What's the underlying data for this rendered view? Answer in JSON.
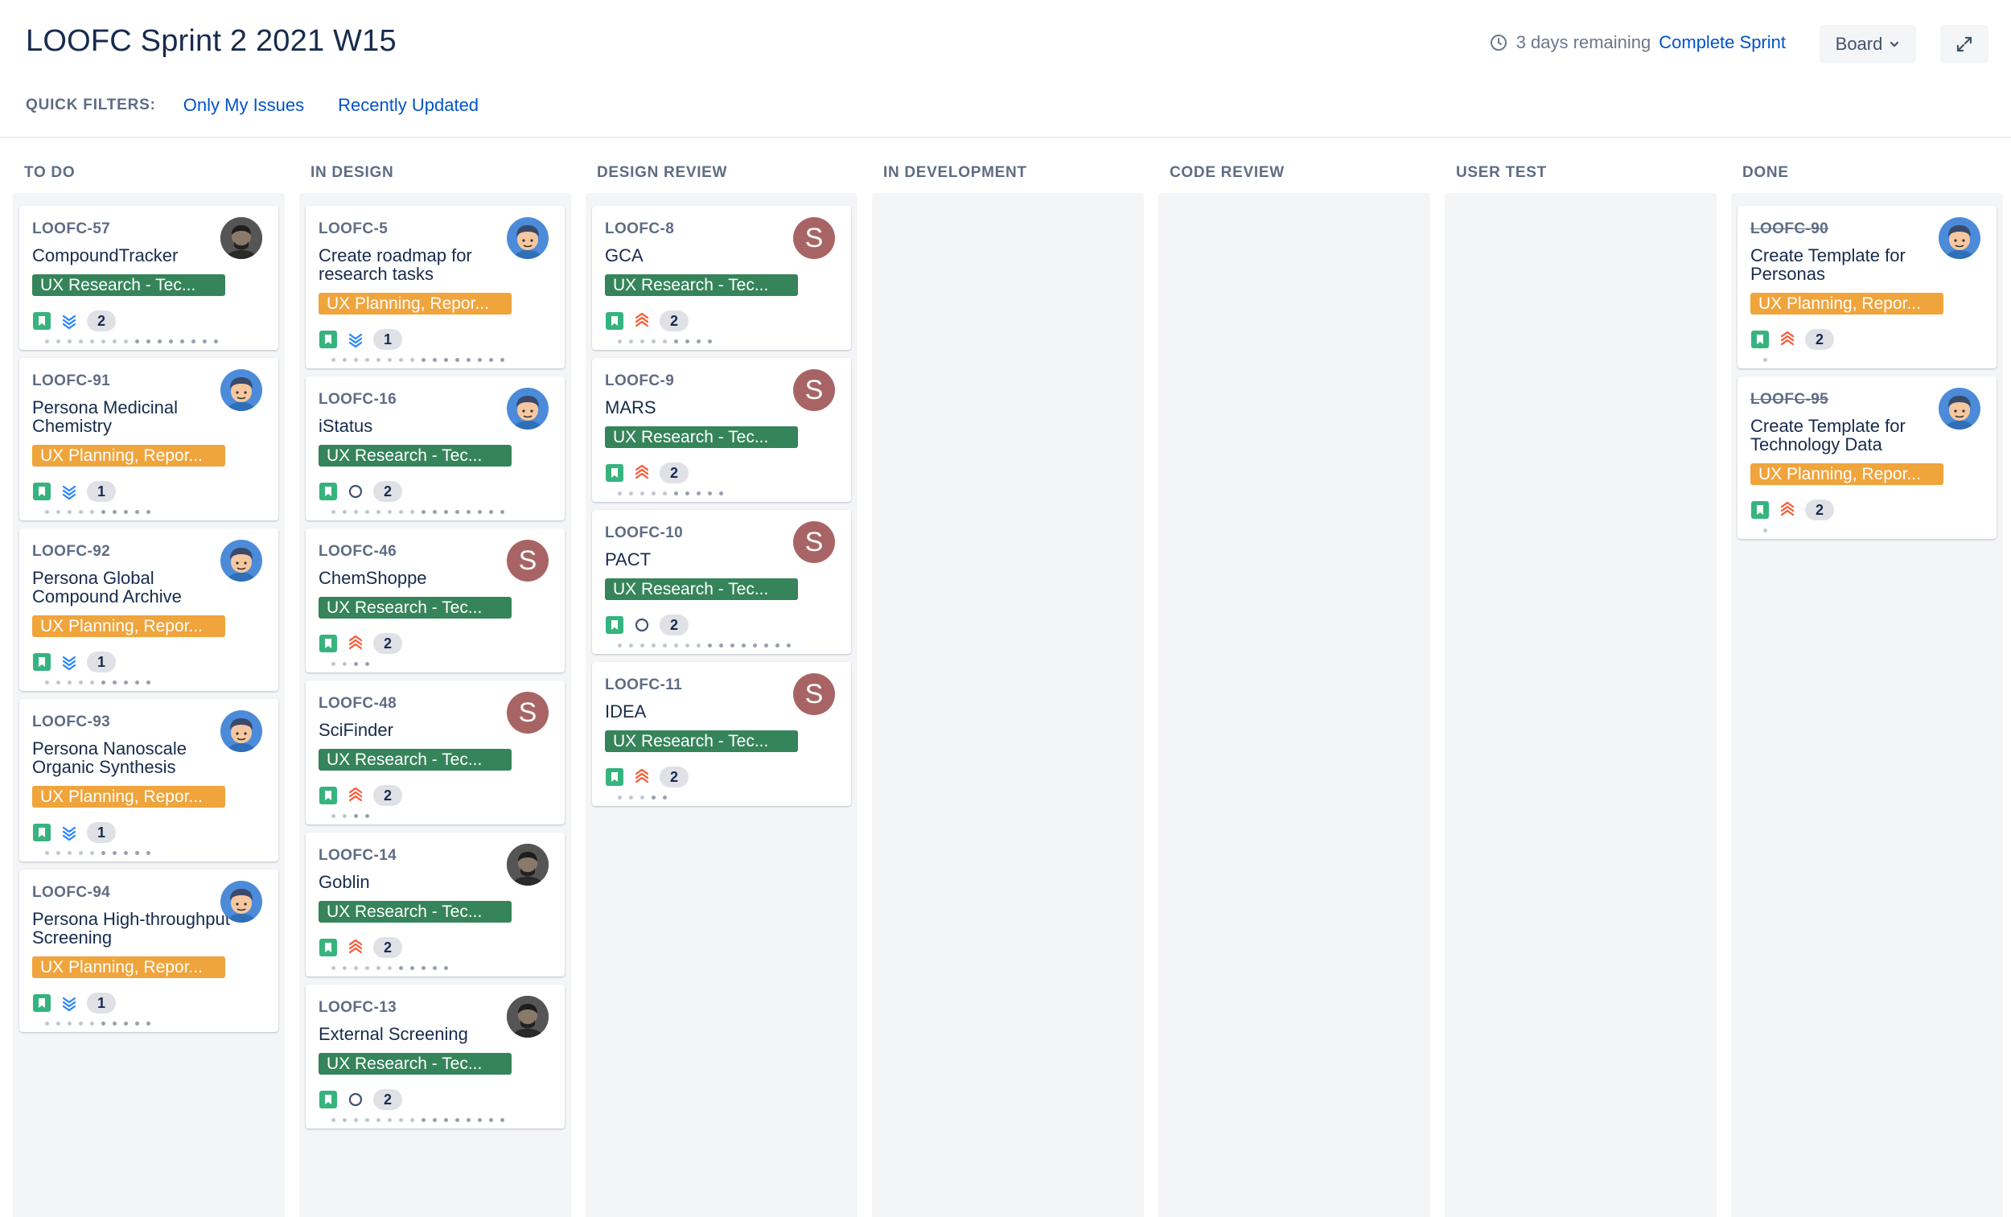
{
  "header": {
    "title": "LOOFC Sprint 2 2021 W15",
    "days_remaining": "3 days remaining",
    "complete_sprint": "Complete Sprint",
    "board_label": "Board",
    "quick_filters_label": "QUICK FILTERS:",
    "quick_filters": [
      "Only My Issues",
      "Recently Updated"
    ]
  },
  "columns": [
    {
      "title": "TO DO",
      "cards": [
        {
          "key": "LOOFC-57",
          "summary": "CompoundTracker",
          "epic": "UX Research - Tec...",
          "epic_color": "green",
          "priority": "lowest",
          "estimate": "2",
          "avatar": "dark",
          "done": false,
          "dots": 16
        },
        {
          "key": "LOOFC-91",
          "summary": "Persona Medicinal Chemistry",
          "epic": "UX Planning, Repor...",
          "epic_color": "orange",
          "priority": "lowest",
          "estimate": "1",
          "avatar": "blue",
          "done": false,
          "dots": 10
        },
        {
          "key": "LOOFC-92",
          "summary": "Persona Global Compound Archive",
          "epic": "UX Planning, Repor...",
          "epic_color": "orange",
          "priority": "lowest",
          "estimate": "1",
          "avatar": "blue",
          "done": false,
          "dots": 10
        },
        {
          "key": "LOOFC-93",
          "summary": "Persona Nanoscale Organic Synthesis",
          "epic": "UX Planning, Repor...",
          "epic_color": "orange",
          "priority": "lowest",
          "estimate": "1",
          "avatar": "blue",
          "done": false,
          "dots": 10
        },
        {
          "key": "LOOFC-94",
          "summary": "Persona High-throughput Screening",
          "epic": "UX Planning, Repor...",
          "epic_color": "orange",
          "priority": "lowest",
          "estimate": "1",
          "avatar": "blue",
          "done": false,
          "dots": 10
        }
      ]
    },
    {
      "title": "IN DESIGN",
      "cards": [
        {
          "key": "LOOFC-5",
          "summary": "Create roadmap for research tasks",
          "epic": "UX Planning, Repor...",
          "epic_color": "orange",
          "priority": "lowest",
          "estimate": "1",
          "avatar": "blue",
          "done": false,
          "dots": 16
        },
        {
          "key": "LOOFC-16",
          "summary": "iStatus",
          "epic": "UX Research - Tec...",
          "epic_color": "green",
          "priority": "none",
          "estimate": "2",
          "avatar": "blue",
          "done": false,
          "dots": 16
        },
        {
          "key": "LOOFC-46",
          "summary": "ChemShoppe",
          "epic": "UX Research - Tec...",
          "epic_color": "green",
          "priority": "highest",
          "estimate": "2",
          "avatar": "s",
          "done": false,
          "dots": 4
        },
        {
          "key": "LOOFC-48",
          "summary": "SciFinder",
          "epic": "UX Research - Tec...",
          "epic_color": "green",
          "priority": "highest",
          "estimate": "2",
          "avatar": "s",
          "done": false,
          "dots": 4
        },
        {
          "key": "LOOFC-14",
          "summary": "Goblin",
          "epic": "UX Research - Tec...",
          "epic_color": "green",
          "priority": "highest",
          "estimate": "2",
          "avatar": "dark",
          "done": false,
          "dots": 11
        },
        {
          "key": "LOOFC-13",
          "summary": "External Screening",
          "epic": "UX Research - Tec...",
          "epic_color": "green",
          "priority": "none",
          "estimate": "2",
          "avatar": "dark",
          "done": false,
          "dots": 16
        }
      ]
    },
    {
      "title": "DESIGN REVIEW",
      "cards": [
        {
          "key": "LOOFC-8",
          "summary": "GCA",
          "epic": "UX Research - Tec...",
          "epic_color": "green",
          "priority": "highest",
          "estimate": "2",
          "avatar": "s",
          "done": false,
          "dots": 9
        },
        {
          "key": "LOOFC-9",
          "summary": "MARS",
          "epic": "UX Research - Tec...",
          "epic_color": "green",
          "priority": "highest",
          "estimate": "2",
          "avatar": "s",
          "done": false,
          "dots": 10
        },
        {
          "key": "LOOFC-10",
          "summary": "PACT",
          "epic": "UX Research - Tec...",
          "epic_color": "green",
          "priority": "none",
          "estimate": "2",
          "avatar": "s",
          "done": false,
          "dots": 16
        },
        {
          "key": "LOOFC-11",
          "summary": "IDEA",
          "epic": "UX Research - Tec...",
          "epic_color": "green",
          "priority": "highest",
          "estimate": "2",
          "avatar": "s",
          "done": false,
          "dots": 5
        }
      ]
    },
    {
      "title": "IN DEVELOPMENT",
      "cards": []
    },
    {
      "title": "CODE REVIEW",
      "cards": []
    },
    {
      "title": "USER TEST",
      "cards": []
    },
    {
      "title": "DONE",
      "cards": [
        {
          "key": "LOOFC-90",
          "summary": "Create Template for Personas",
          "epic": "UX Planning, Repor...",
          "epic_color": "orange",
          "priority": "highest",
          "estimate": "2",
          "avatar": "blue",
          "done": true,
          "dots": 1
        },
        {
          "key": "LOOFC-95",
          "summary": "Create Template for Technology Data",
          "epic": "UX Planning, Repor...",
          "epic_color": "orange",
          "priority": "highest",
          "estimate": "2",
          "avatar": "blue",
          "done": true,
          "dots": 1
        }
      ]
    }
  ],
  "icons": {
    "story": "story-bookmark-icon",
    "lowest": "priority-lowest-icon",
    "highest": "priority-highest-icon",
    "none": "status-circle-icon"
  },
  "colors": {
    "epic_green": "#36845a",
    "epic_orange": "#f0a43c",
    "link": "#0052cc",
    "story": "#36b37e",
    "priority_low": "#2684ff",
    "priority_high": "#ff5630"
  }
}
